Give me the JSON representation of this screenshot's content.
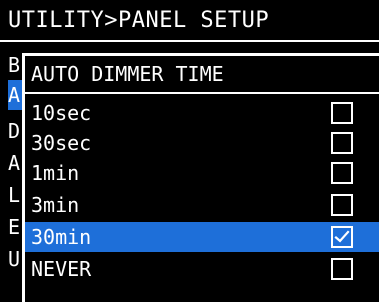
{
  "header": {
    "title": "UTILITY>PANEL SETUP"
  },
  "background_menu": {
    "items": [
      {
        "label": "B",
        "selected": false
      },
      {
        "label": "A",
        "selected": true
      },
      {
        "label": "D",
        "selected": false
      },
      {
        "label": "A",
        "selected": false
      },
      {
        "label": "L",
        "selected": false
      },
      {
        "label": "E",
        "selected": false
      },
      {
        "label": "U",
        "selected": false
      }
    ]
  },
  "dialog": {
    "title": "AUTO DIMMER TIME",
    "options": [
      {
        "label": "10sec",
        "checked": false,
        "selected": false
      },
      {
        "label": "30sec",
        "checked": false,
        "selected": false
      },
      {
        "label": "1min",
        "checked": false,
        "selected": false
      },
      {
        "label": "3min",
        "checked": false,
        "selected": false
      },
      {
        "label": "30min",
        "checked": true,
        "selected": true
      },
      {
        "label": "NEVER",
        "checked": false,
        "selected": false
      }
    ]
  },
  "colors": {
    "background": "#000000",
    "foreground": "#ffffff",
    "selection": "#1e6fd9"
  }
}
